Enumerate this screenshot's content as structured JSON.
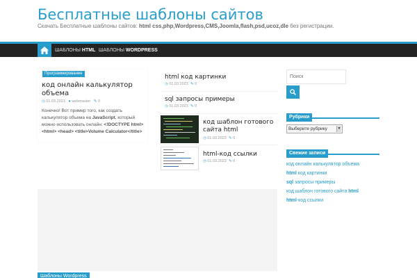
{
  "site": {
    "title": "Бесплатные шаблоны сайтов",
    "desc_prefix": "Скачать Бесплатные шаблоны сайтов: ",
    "desc_bold": "html css,php,Wordpress,CMS,Joomla,flash,psd,ucoz,dle",
    "desc_suffix": " без регистрации."
  },
  "nav": {
    "home_icon": "home-icon",
    "items": [
      {
        "prefix": "ШАБЛОНЫ ",
        "bold": "HTML"
      },
      {
        "prefix": "ШАБЛОНЫ ",
        "bold": "WORDPRESS"
      }
    ]
  },
  "featured": {
    "category": "Программирование",
    "title": "код онлайн калькулятор объема",
    "date": "01.03.2023",
    "author": "webmaster",
    "comments": "0",
    "excerpt_1": "Конечно! Вот пример того, как создать калькулятор объема на ",
    "excerpt_bold_1": "JavaScript",
    "excerpt_2": ", который можно использовать онлайн: ",
    "excerpt_bold_2": "<!DOCTYPE html> <html> <head> <title>Volume Calculator</title>"
  },
  "posts": [
    {
      "title": "html код картинки",
      "date": "01.03.2023",
      "comments": "0"
    },
    {
      "title": "sql запросы примеры",
      "date": "01.03.2023",
      "comments": "0"
    },
    {
      "title": "код шаблон готового сайта html",
      "date": "01.03.2023",
      "comments": "0"
    },
    {
      "title": "html-код ссылки",
      "date": "01.03.2023",
      "comments": "0"
    }
  ],
  "sidebar": {
    "search_placeholder": "Поиск",
    "categories_title": "Рубрики",
    "categories_select": "Выберите рубрику",
    "recent_title": "Свежие записи",
    "recent": [
      {
        "bold": "",
        "text": "код онлайн калькулятор объема",
        "bold_after": ""
      },
      {
        "bold": "html",
        "text": " код картинки",
        "bold_after": ""
      },
      {
        "bold": "sql",
        "text": " запросы примеры",
        "bold_after": ""
      },
      {
        "bold": "",
        "text": "код шаблон готового сайта ",
        "bold_after": "html"
      },
      {
        "bold": "html",
        "text": "-код ссылки",
        "bold_after": ""
      }
    ]
  },
  "bottom_tag": "Шаблоны Wordpress",
  "colors": {
    "accent": "#289dcc",
    "nav_bg": "#232323"
  }
}
